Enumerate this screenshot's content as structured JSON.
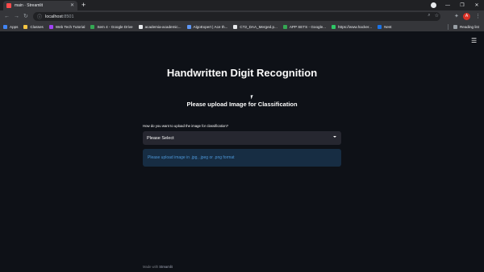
{
  "browser": {
    "tab_title": "main · Streamlit",
    "new_tab_label": "+",
    "url_host": "localhost",
    "url_port": ":8501",
    "avatar_letter": "A",
    "bookmarks": [
      {
        "label": "Apps",
        "color": "#4285f4"
      },
      {
        "label": "Classes",
        "color": "#f5c542"
      },
      {
        "label": "Web Tech Tutorial",
        "color": "#a142f4"
      },
      {
        "label": "Sem 4 - Google Drive",
        "color": "#34a853"
      },
      {
        "label": "academia-academic...",
        "color": "#e8eaed"
      },
      {
        "label": "AlgoExpert | Ace th...",
        "color": "#5e97f6"
      },
      {
        "label": "CT2_DAA_Merged.p...",
        "color": "#e8eaed"
      },
      {
        "label": "APP SETS - Google...",
        "color": "#34a853"
      },
      {
        "label": "https://www.hacker...",
        "color": "#2ec866"
      },
      {
        "label": "Nest",
        "color": "#1a73e8"
      }
    ],
    "reading_list_label": "Reading list"
  },
  "app": {
    "title": "Handwritten Digit Recognition",
    "subtitle": "Please upload Image for Classification",
    "select_label": "How do you want to upload the image for classification?",
    "select_value": "Please Select",
    "info_text": "Please upload image in .jpg, .jpeg or .png format",
    "footer_prefix": "Made with",
    "footer_brand": "Streamlit"
  },
  "colors": {
    "background": "#0e1117",
    "select_bg": "#262730",
    "info_bg": "#172d43",
    "info_text": "#4c96d7"
  }
}
